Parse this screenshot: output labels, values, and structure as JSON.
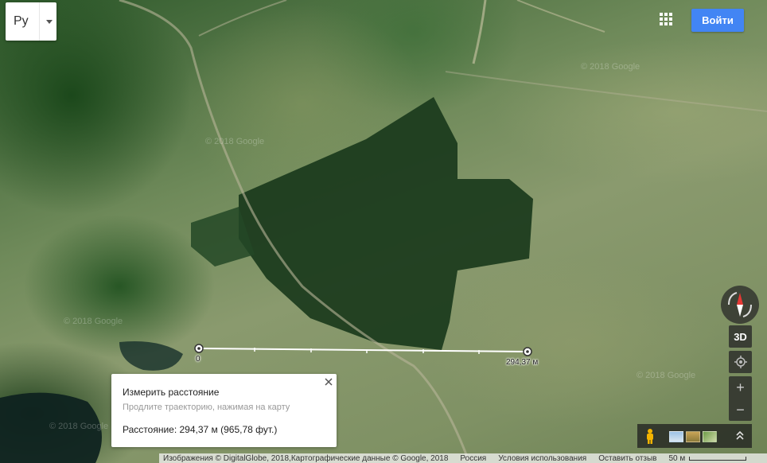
{
  "language_select": {
    "value": "Ру"
  },
  "header": {
    "signin_label": "Войти"
  },
  "measurement": {
    "start_label": "0",
    "end_label": "294,37 м",
    "card": {
      "title": "Измерить расстояние",
      "hint": "Продлите траекторию, нажимая на карту",
      "distance": "Расстояние: 294,37 м (965,78 фут.)"
    }
  },
  "controls": {
    "three_d_label": "3D",
    "zoom_in_label": "+",
    "zoom_out_label": "−"
  },
  "footer": {
    "attribution": "Изображения © DigitalGlobe, 2018,Картографические данные © Google, 2018",
    "country": "Россия",
    "terms": "Условия использования",
    "feedback": "Оставить отзыв",
    "scale": "50 м"
  },
  "watermarks": [
    "© 2018 Google",
    "© 2018 Google",
    "© 2018 Google",
    "© 2018 Google",
    "© 2018 Google"
  ],
  "colors": {
    "accent": "#4285f4",
    "measure_line": "#ffffff",
    "compass_north": "#e53935"
  },
  "icons": {
    "apps": "apps-grid-icon",
    "close": "close-icon",
    "compass": "compass-icon",
    "locate": "my-location-icon",
    "pegman": "pegman-icon",
    "expand": "expand-icon"
  }
}
